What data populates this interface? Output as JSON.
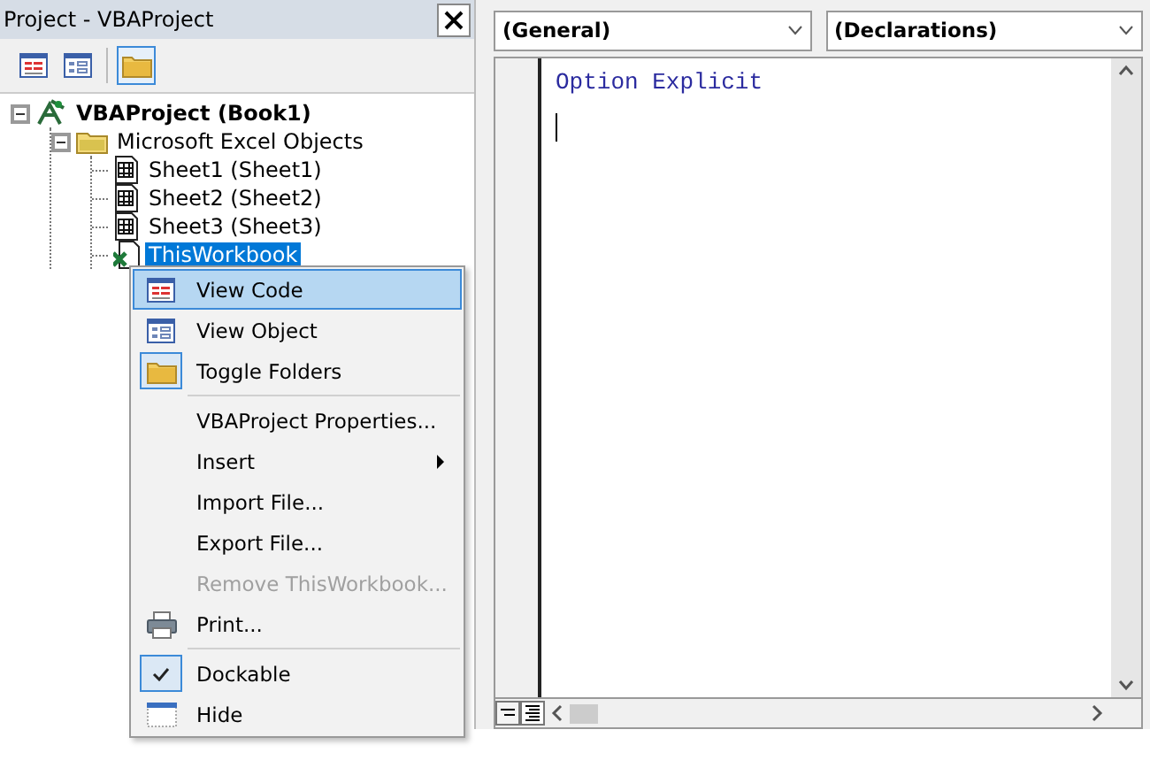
{
  "project_panel": {
    "title": "Project - VBAProject",
    "toolbar": [
      {
        "kind": "code",
        "selected": false
      },
      {
        "kind": "object",
        "selected": false
      },
      {
        "kind": "folder",
        "selected": true
      }
    ],
    "tree": [
      {
        "label": "VBAProject (Book1)",
        "kind": "project",
        "expanded": true,
        "selected": false,
        "children": [
          {
            "label": "Microsoft Excel Objects",
            "kind": "folder",
            "expanded": true,
            "selected": false,
            "children": [
              {
                "label": "Sheet1 (Sheet1)",
                "kind": "sheet",
                "selected": false
              },
              {
                "label": "Sheet2 (Sheet2)",
                "kind": "sheet",
                "selected": false
              },
              {
                "label": "Sheet3 (Sheet3)",
                "kind": "sheet",
                "selected": false
              },
              {
                "label": "ThisWorkbook",
                "kind": "workbook",
                "selected": true
              }
            ]
          }
        ]
      }
    ]
  },
  "context_menu": [
    {
      "label": "View Code",
      "kind": "code",
      "selected": true,
      "disabled": false,
      "separator_before": false
    },
    {
      "label": "View Object",
      "kind": "object",
      "selected": false,
      "disabled": false,
      "separator_before": false
    },
    {
      "label": "Toggle Folders",
      "kind": "folder",
      "selected": false,
      "disabled": false,
      "separator_before": false
    },
    {
      "label": "VBAProject Properties...",
      "selected": false,
      "disabled": false,
      "separator_before": true
    },
    {
      "label": "Insert",
      "selected": false,
      "disabled": false,
      "submenu": true,
      "separator_before": false
    },
    {
      "label": "Import File...",
      "selected": false,
      "disabled": false,
      "separator_before": false
    },
    {
      "label": "Export File...",
      "selected": false,
      "disabled": false,
      "separator_before": false
    },
    {
      "label": "Remove ThisWorkbook...",
      "selected": false,
      "disabled": true,
      "separator_before": false
    },
    {
      "label": "Print...",
      "kind": "print",
      "selected": false,
      "disabled": false,
      "separator_before": false
    },
    {
      "label": "Dockable",
      "selected": false,
      "disabled": false,
      "checked": true,
      "separator_before": true
    },
    {
      "label": "Hide",
      "kind": "hide",
      "selected": false,
      "disabled": false,
      "separator_before": false
    }
  ],
  "code_window": {
    "object_dropdown": "(General)",
    "procedure_dropdown": "(Declarations)",
    "lines": [
      "Option Explicit"
    ]
  }
}
